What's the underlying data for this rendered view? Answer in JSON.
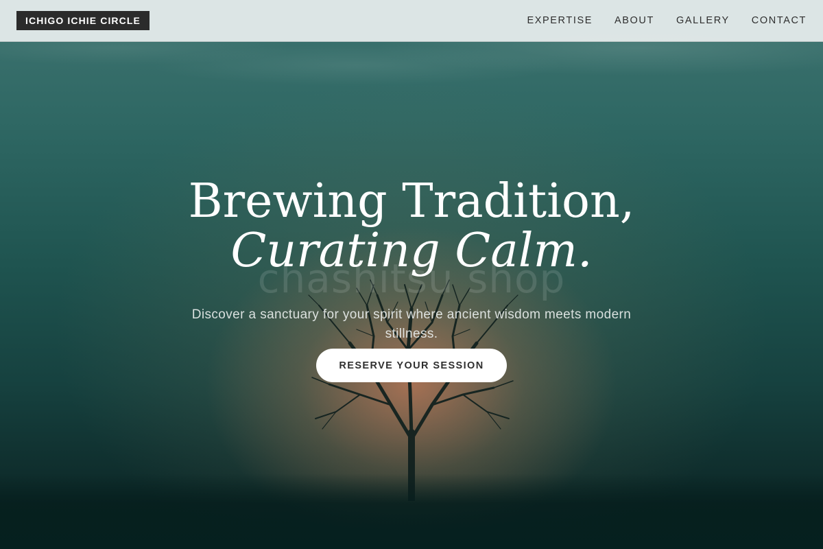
{
  "header": {
    "logo": "ICHIGO ICHIE CIRCLE",
    "nav": [
      "EXPERTISE",
      "ABOUT",
      "GALLERY",
      "CONTACT"
    ]
  },
  "hero": {
    "watermark": "chashitsu shop",
    "headline_line1": "Brewing Tradition,",
    "headline_line2": "Curating Calm.",
    "subtitle": "Discover a sanctuary for your spirit where ancient wisdom meets modern stillness.",
    "cta": "RESERVE YOUR SESSION",
    "background": "tree-silhouette-sunset"
  },
  "colors": {
    "header_bg": "#e8eeee",
    "logo_bg": "#2b2b2b",
    "teal_sky": "#2f6864",
    "sunset_glow": "#c67a58",
    "cta_bg": "#ffffff"
  }
}
